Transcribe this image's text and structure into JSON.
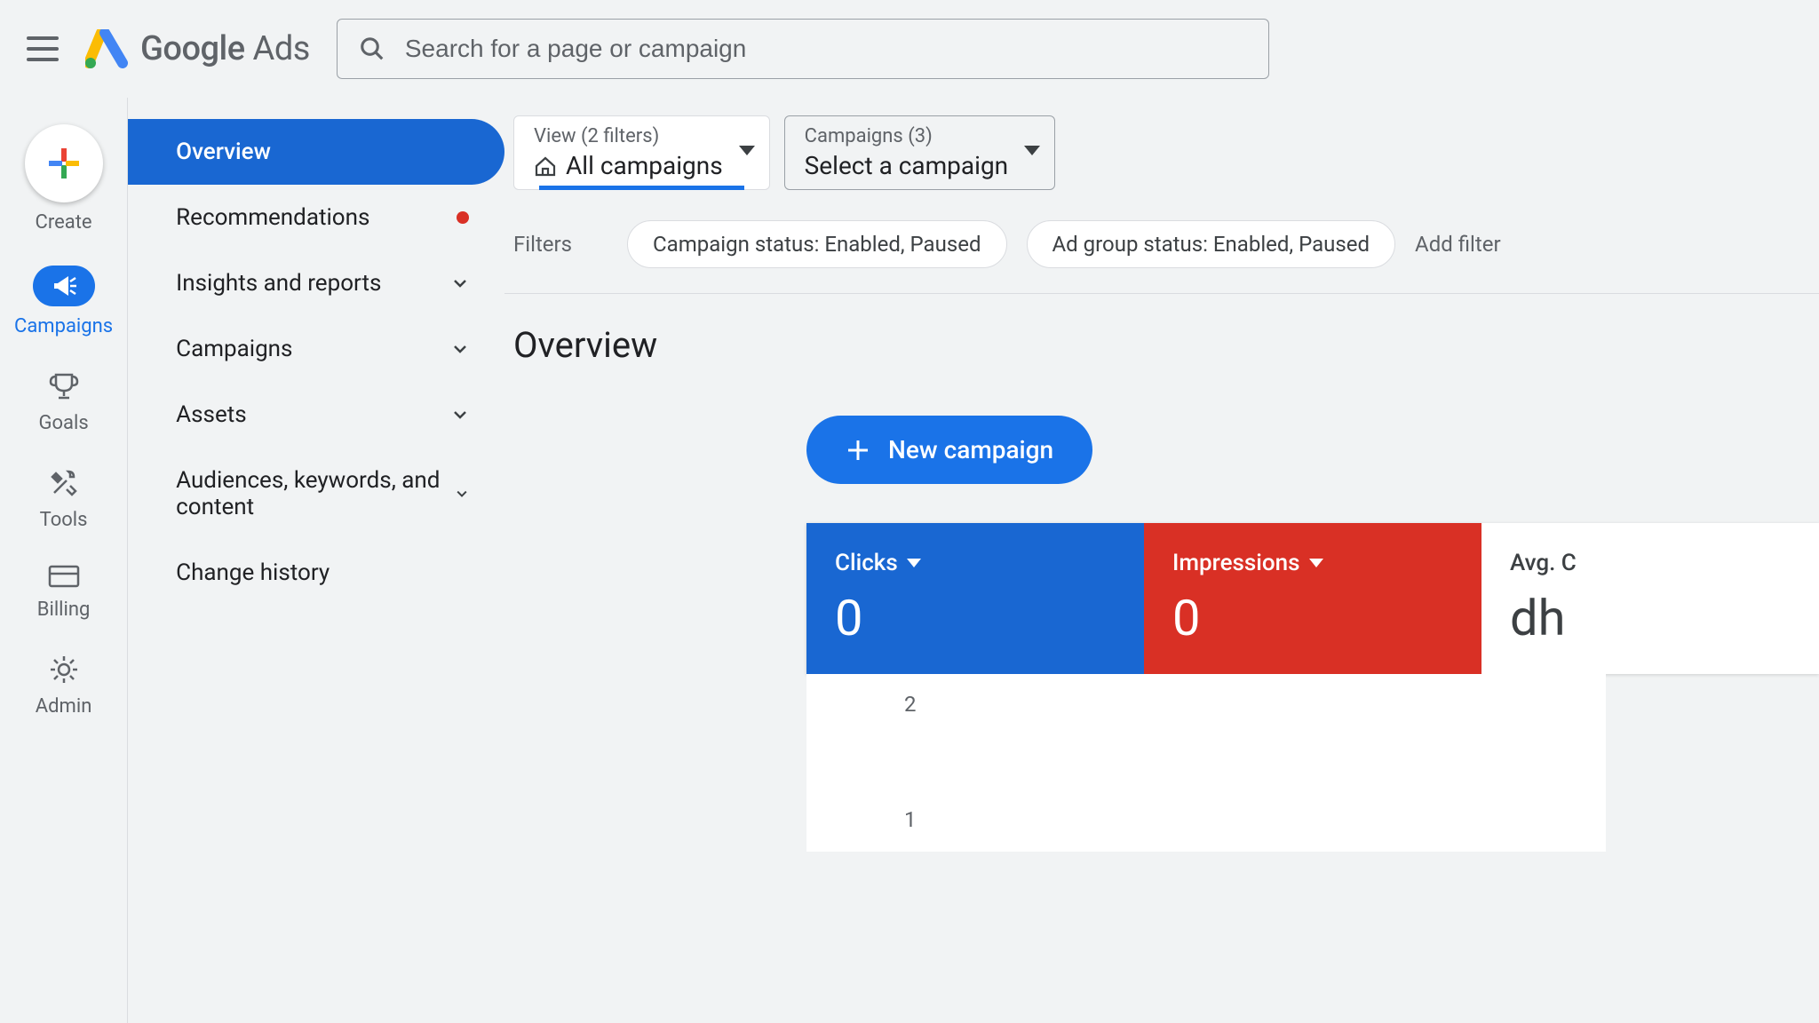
{
  "header": {
    "brand_bold": "Google",
    "brand_light": "Ads",
    "search_placeholder": "Search for a page or campaign"
  },
  "rail": {
    "create": "Create",
    "campaigns": "Campaigns",
    "goals": "Goals",
    "tools": "Tools",
    "billing": "Billing",
    "admin": "Admin"
  },
  "sidenav": {
    "overview": "Overview",
    "recommendations": "Recommendations",
    "insights": "Insights and reports",
    "campaigns": "Campaigns",
    "assets": "Assets",
    "audiences": "Audiences, keywords, and content",
    "change_history": "Change history"
  },
  "top": {
    "view_label": "View (2 filters)",
    "view_value": "All campaigns",
    "camp_label": "Campaigns (3)",
    "camp_value": "Select a campaign"
  },
  "filters": {
    "label": "Filters",
    "chip1": "Campaign status: Enabled, Paused",
    "chip2": "Ad group status: Enabled, Paused",
    "add": "Add filter"
  },
  "page_title": "Overview",
  "new_campaign": "New campaign",
  "metrics": {
    "clicks_label": "Clicks",
    "clicks_value": "0",
    "impressions_label": "Impressions",
    "impressions_value": "0",
    "avg_label": "Avg. C",
    "avg_value": "dh"
  },
  "chart_data": {
    "type": "line",
    "yticks": [
      "2",
      "1"
    ],
    "title": "",
    "xlabel": "",
    "ylabel": "",
    "ylim": [
      0,
      2
    ],
    "series": []
  }
}
